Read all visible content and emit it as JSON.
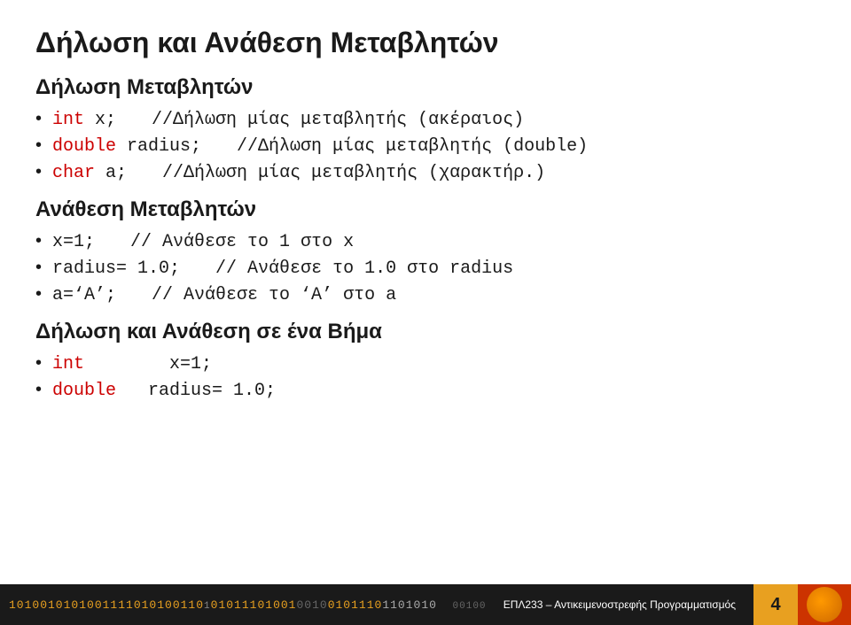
{
  "slide": {
    "main_title": "Δήλωση και Ανάθεση Μεταβλητών",
    "section1": {
      "title": "Δήλωση Μεταβλητών",
      "items": [
        {
          "keyword": "int",
          "code": " x;",
          "comment": "//Δήλωση μίας μεταβλητής (ακέραιος)"
        },
        {
          "keyword": "double",
          "code": " radius;",
          "comment": "//Δήλωση μίας μεταβλητής (double)"
        },
        {
          "keyword": "char",
          "code": " a;",
          "comment": "//Δήλωση μίας μεταβλητής (χαρακτήρ.)"
        }
      ]
    },
    "section2": {
      "title": "Ανάθεση Μεταβλητών",
      "items": [
        {
          "code": "x=1;",
          "comment": "// Ανάθεσε το 1 στο x"
        },
        {
          "code": "radius= 1.0;",
          "comment": "// Ανάθεσε το 1.0 στο radius"
        },
        {
          "code": "a=‘A’;",
          "comment": "// Ανάθεσε το ‘A’ στο a"
        }
      ]
    },
    "section3": {
      "title": "Δήλωση και Ανάθεση σε ένα Βήμα",
      "items": [
        {
          "keyword": "int",
          "tab": "       ",
          "code": "x=1;"
        },
        {
          "keyword": "double",
          "tab": "   ",
          "code": "radius= 1.0;"
        }
      ]
    }
  },
  "footer": {
    "binary_text": "101001010100111101010011010111010010",
    "binary_text2": "001001011101101010",
    "course_label": "ΕΠΛ233 – Αντικειμενοστρεφής Προγραμματισμός",
    "page_number": "4"
  }
}
